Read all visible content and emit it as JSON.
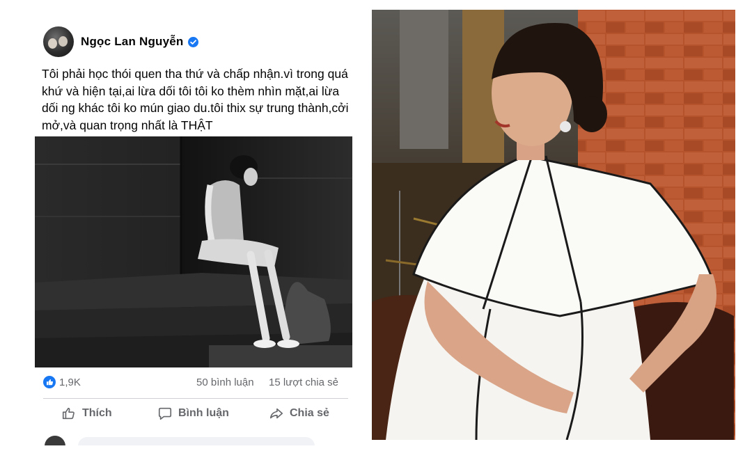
{
  "post": {
    "author": {
      "name": "Ngọc Lan Nguyễn",
      "verified": true,
      "verified_icon": "verified-badge-icon",
      "verified_color": "#1877f2"
    },
    "text": "Tôi phải học thói quen tha thứ và chấp nhận.vì trong quá khứ và hiện tại,ai lừa dối tôi tôi ko thèm nhìn mặt,ai lừa dối ng khác tôi ko mún giao du.tôi thix sự trung thành,cởi mở,và quan trọng nhất là THẬT",
    "reactions": {
      "like_count": "1,9K",
      "like_icon": "like-reaction-icon",
      "comments": "50 bình luận",
      "shares": "15 lượt chia sẻ"
    },
    "actions": {
      "like_label": "Thích",
      "comment_label": "Bình luận",
      "share_label": "Chia sẻ"
    }
  },
  "colors": {
    "text": "#050505",
    "secondary_text": "#65676b",
    "facebook_blue": "#1877f2",
    "brick": "#b5532c"
  }
}
